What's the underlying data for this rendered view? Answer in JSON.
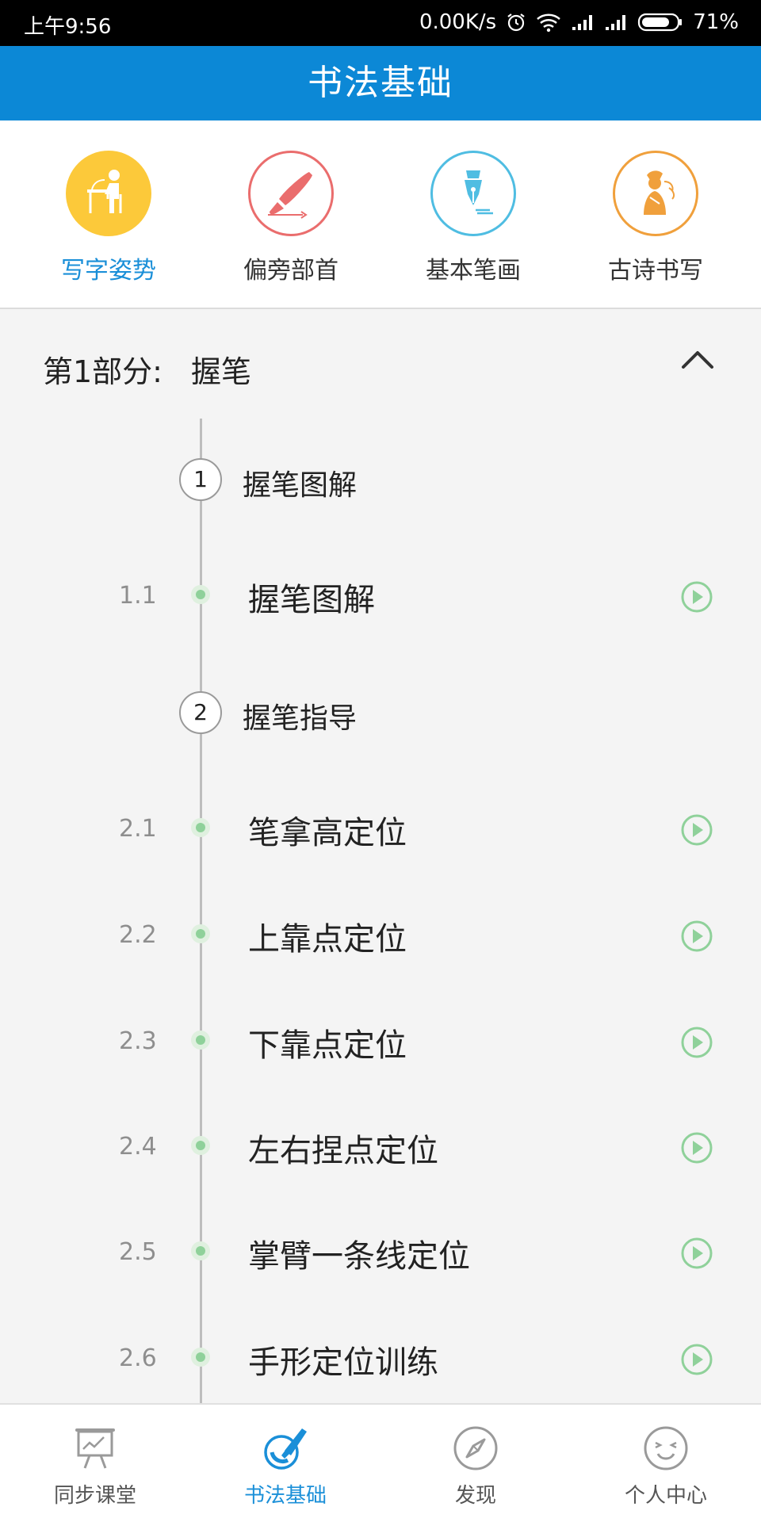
{
  "status_bar": {
    "time": "上午9:56",
    "network_speed": "0.00K/s",
    "battery": "71%"
  },
  "header": {
    "title": "书法基础"
  },
  "categories": [
    {
      "label": "写字姿势",
      "color": "#fcc93a",
      "icon": "sitting-writing-icon",
      "active": true
    },
    {
      "label": "偏旁部首",
      "color": "#ea6d6d",
      "icon": "brush-icon",
      "active": false
    },
    {
      "label": "基本笔画",
      "color": "#4fbde2",
      "icon": "pen-nib-icon",
      "active": false
    },
    {
      "label": "古诗书写",
      "color": "#f0a03c",
      "icon": "poet-icon",
      "active": false
    }
  ],
  "section": {
    "title": "第1部分:",
    "name": "握笔"
  },
  "groups": [
    {
      "num": "1",
      "title": "握笔图解"
    },
    {
      "num": "2",
      "title": "握笔指导"
    }
  ],
  "lessons": [
    {
      "idx": "1.1",
      "title": "握笔图解"
    },
    {
      "idx": "2.1",
      "title": "笔拿高定位"
    },
    {
      "idx": "2.2",
      "title": "上靠点定位"
    },
    {
      "idx": "2.3",
      "title": "下靠点定位"
    },
    {
      "idx": "2.4",
      "title": "左右捏点定位"
    },
    {
      "idx": "2.5",
      "title": "掌臂一条线定位"
    },
    {
      "idx": "2.6",
      "title": "手形定位训练"
    }
  ],
  "tabs": [
    {
      "label": "同步课堂",
      "icon": "presentation-board-icon"
    },
    {
      "label": "书法基础",
      "icon": "brush-pot-icon",
      "active": true
    },
    {
      "label": "发现",
      "icon": "compass-icon"
    },
    {
      "label": "个人中心",
      "icon": "smiley-face-icon"
    }
  ],
  "colors": {
    "accent": "#0c88d6",
    "play_green": "#8fd19a"
  }
}
